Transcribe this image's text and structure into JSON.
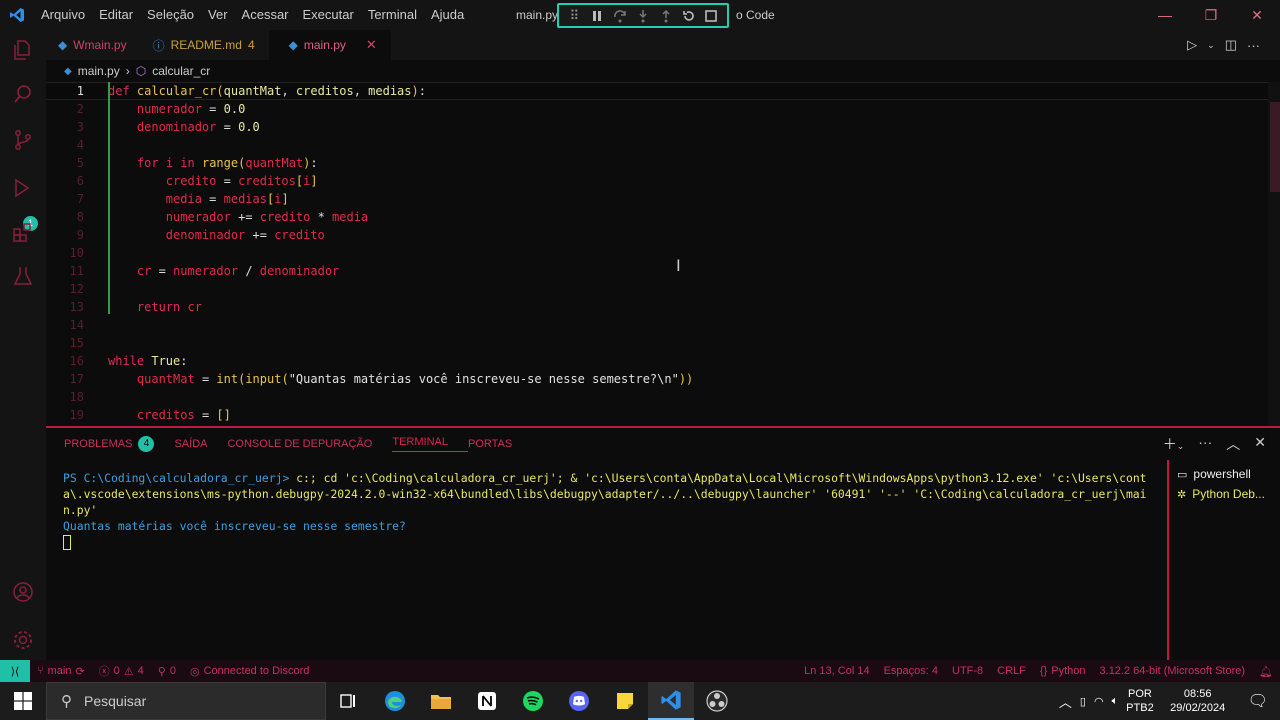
{
  "titlebar": {
    "menu": [
      "Arquivo",
      "Editar",
      "Seleção",
      "Ver",
      "Acessar",
      "Executar",
      "Terminal",
      "Ajuda"
    ],
    "title_left": "main.py",
    "title_right": "o Code"
  },
  "tabs": [
    {
      "label": "Wmain.py",
      "modified": ""
    },
    {
      "label": "README.md",
      "modified": "4"
    },
    {
      "label": "main.py",
      "modified": ""
    }
  ],
  "breadcrumb": {
    "file": "main.py",
    "symbol": "calcular_cr"
  },
  "editor": {
    "line_numbers": [
      "1",
      "2",
      "3",
      "4",
      "5",
      "6",
      "7",
      "8",
      "9",
      "10",
      "11",
      "12",
      "13",
      "14",
      "15",
      "16",
      "17",
      "18",
      "19"
    ]
  },
  "panel": {
    "tabs": [
      "PROBLEMAS",
      "SAÍDA",
      "CONSOLE DE DEPURAÇÃO",
      "TERMINAL",
      "PORTAS"
    ],
    "problems_count": "4",
    "terminal_prompt": "PS C:\\Coding\\calculadora_cr_uerj> ",
    "terminal_command": "c:; cd 'c:\\Coding\\calculadora_cr_uerj'; & 'c:\\Users\\conta\\AppData\\Local\\Microsoft\\WindowsApps\\python3.12.exe' 'c:\\Users\\conta\\.vscode\\extensions\\ms-python.debugpy-2024.2.0-win32-x64\\bundled\\libs\\debugpy\\adapter/../..\\debugpy\\launcher' '60491' '--' 'C:\\Coding\\calculadora_cr_uerj\\main.py'",
    "terminal_output": "Quantas matérias você inscreveu-se nesse semestre?",
    "terminal_list": [
      "powershell",
      "Python Deb..."
    ]
  },
  "statusbar": {
    "branch": "main",
    "errors": "0",
    "warnings": "4",
    "ports": "0",
    "discord": "Connected to Discord",
    "position": "Ln 13, Col 14",
    "spaces": "Espaços: 4",
    "encoding": "UTF-8",
    "eol": "CRLF",
    "language": "Python",
    "interpreter": "3.12.2 64-bit (Microsoft Store)"
  },
  "taskbar": {
    "search_placeholder": "Pesquisar",
    "lang_top": "POR",
    "lang_bottom": "PTB2",
    "time": "08:56",
    "date": "29/02/2024"
  },
  "colors": {
    "accent": "#e02050",
    "remote": "#1fbfa8",
    "debug_toolbar_border": "#1fd1b0"
  }
}
